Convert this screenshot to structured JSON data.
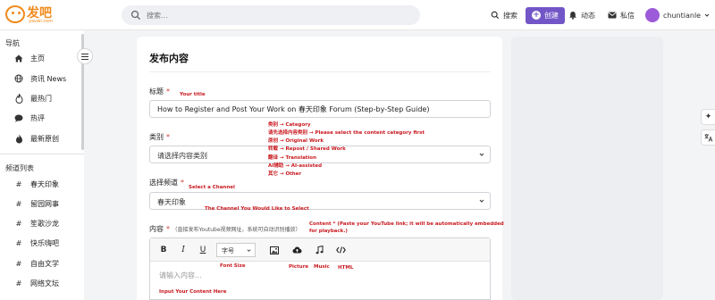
{
  "header": {
    "logo_text": "发吧",
    "logo_sub": "yavaii.com",
    "search_placeholder": "搜索...",
    "search_label": "搜索",
    "create_label": "创建",
    "activity_label": "动态",
    "messages_label": "私信",
    "username": "chuntianle"
  },
  "sidebar": {
    "nav_title": "导航",
    "nav_items": [
      {
        "label": "主页",
        "icon": "home-icon"
      },
      {
        "label": "资讯 News",
        "icon": "globe-icon"
      },
      {
        "label": "最热门",
        "icon": "flame-icon"
      },
      {
        "label": "热评",
        "icon": "comment-icon"
      },
      {
        "label": "最新原创",
        "icon": "fire-icon"
      }
    ],
    "channels_title": "频道列表",
    "channels": [
      {
        "label": "春天印象"
      },
      {
        "label": "留园网事"
      },
      {
        "label": "笙歌沙龙"
      },
      {
        "label": "快乐嗨吧"
      },
      {
        "label": "自由文学"
      },
      {
        "label": "网络文坛"
      }
    ],
    "channel_prefix": "#"
  },
  "form": {
    "page_title": "发布内容",
    "title_label": "标题",
    "required_mark": "*",
    "title_value": "How to Register and Post Your Work on 春天印象 Forum (Step-by-Step Guide)",
    "category_label": "类别",
    "category_placeholder": "请选择内容类别",
    "channel_label": "选择频道",
    "channel_value": "春天印象",
    "content_label": "内容",
    "content_hint": "（直接发布Youtube视频网址，系统可自动识别播放）",
    "font_size_label": "字号",
    "editor_placeholder": "请输入内容..."
  },
  "annotations": {
    "your_title": "Your title",
    "category_lines": [
      "类别 → Category",
      "请先选择内容类别 → Please select the content category first",
      "原创 → Original Work",
      "转载 → Repost / Shared Work",
      "翻译 → Translation",
      "AI辅助 → AI-assisted",
      "其它 → Other"
    ],
    "select_channel": "Select a Channel",
    "channel_like": "The Channel You Would Like to  Select",
    "content_note_1": "Content * (Paste your YouTube link; it will be automatically embedded",
    "content_note_2": "for playback.)",
    "font_size": "Font Size",
    "picture": "Picture",
    "music": "Music",
    "html": "HTML",
    "input_content": "Input Your Content Here"
  },
  "colors": {
    "brand_orange": "#f08a1c",
    "create_button": "#7256c7",
    "annotation_red": "#c8191f",
    "required_red": "#d03a3a"
  }
}
